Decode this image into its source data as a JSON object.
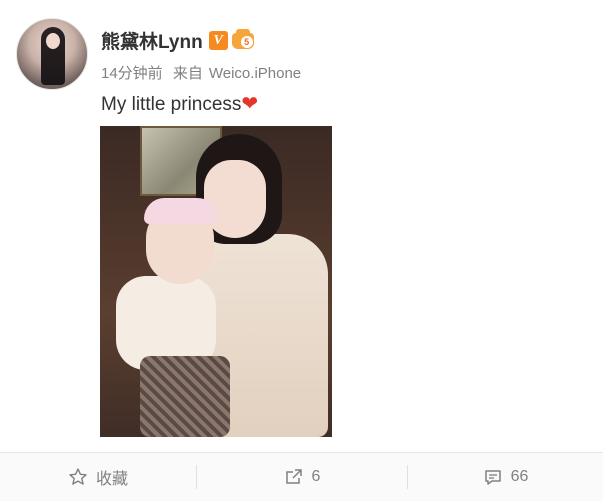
{
  "post": {
    "author": "熊黛林Lynn",
    "verified_badge": "V",
    "level_badge": "5",
    "time": "14分钟前",
    "source_prefix": "来自",
    "source": "Weico.iPhone",
    "text": "My little princess",
    "emoji": "❤"
  },
  "actions": {
    "favorite_label": "收藏",
    "repost_count": "6",
    "comment_count": "66"
  },
  "colors": {
    "verified": "#f78a1f",
    "heart": "#e5362b",
    "meta_text": "#808080"
  }
}
